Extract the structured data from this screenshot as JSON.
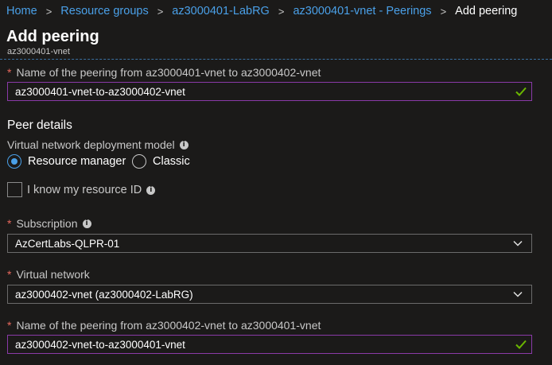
{
  "breadcrumb": {
    "items": [
      "Home",
      "Resource groups",
      "az3000401-LabRG",
      "az3000401-vnet - Peerings"
    ],
    "current": "Add peering",
    "separator": ">"
  },
  "header": {
    "title": "Add peering",
    "subtitle": "az3000401-vnet"
  },
  "form": {
    "required_marker": "*",
    "peering_name": {
      "label": "Name of the peering from az3000401-vnet to az3000402-vnet",
      "value": "az3000401-vnet-to-az3000402-vnet"
    },
    "peer_details_heading": "Peer details",
    "deployment_model": {
      "label": "Virtual network deployment model",
      "options": [
        "Resource manager",
        "Classic"
      ],
      "selected": "Resource manager"
    },
    "resource_id_checkbox": {
      "label": "I know my resource ID",
      "checked": false
    },
    "subscription": {
      "label": "Subscription",
      "value": "AzCertLabs-QLPR-01"
    },
    "virtual_network": {
      "label": "Virtual network",
      "value": "az3000402-vnet (az3000402-LabRG)"
    },
    "remote_peering_name": {
      "label": "Name of the peering from az3000402-vnet to az3000401-vnet",
      "value": "az3000402-vnet-to-az3000401-vnet"
    }
  },
  "colors": {
    "background": "#1b1a19",
    "link": "#4aa0e8",
    "required": "#e8685d",
    "valid_border": "#8a3aa8",
    "check": "#6bb700"
  },
  "icons": {
    "info": "info-icon",
    "valid": "check-icon",
    "dropdown": "chevron-down-icon"
  }
}
